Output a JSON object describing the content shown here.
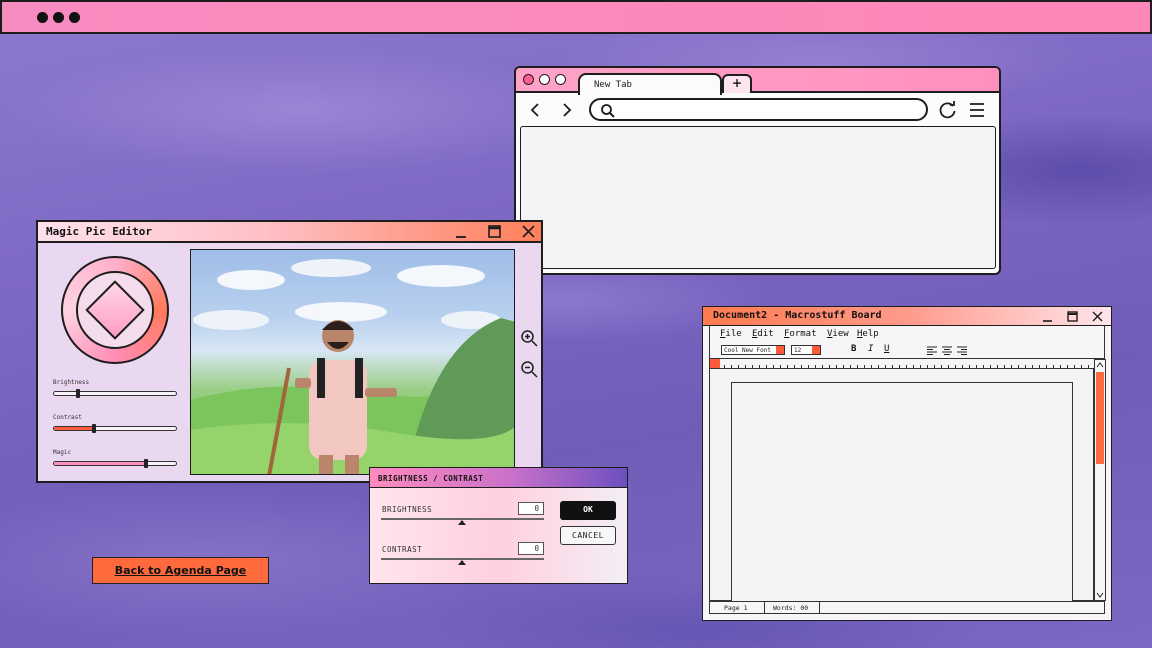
{
  "browser": {
    "tab_label": "New Tab",
    "new_tab_symbol": "+",
    "address_value": ""
  },
  "pic_editor": {
    "title": "Magic Pic Editor",
    "sliders": [
      {
        "label": "Brightness",
        "value": 0.2,
        "fill": "#f9f1f8"
      },
      {
        "label": "Contrast",
        "value": 0.33,
        "fill": "#ff5a3c"
      },
      {
        "label": "Magic",
        "value": 0.75,
        "fill": "#ff8fc0"
      }
    ]
  },
  "brightness_dialog": {
    "title": "BRIGHTNESS / CONTRAST",
    "brightness_label": "BRIGHTNESS",
    "brightness_value": "0",
    "contrast_label": "CONTRAST",
    "contrast_value": "0",
    "ok_label": "OK",
    "cancel_label": "CANCEL"
  },
  "document": {
    "title": "Document2 - Macrostuff Board",
    "menus": [
      {
        "accel": "F",
        "rest": "ile"
      },
      {
        "accel": "E",
        "rest": "dit"
      },
      {
        "accel": "F",
        "rest": "ormat"
      },
      {
        "accel": "V",
        "rest": "iew"
      },
      {
        "accel": "H",
        "rest": "elp"
      }
    ],
    "font_name": "Cool New Font",
    "font_size": "12",
    "bold": "B",
    "italic": "I",
    "underline": "U",
    "status_page": "Page 1",
    "status_words": "Words: 00"
  },
  "back_button": "Back to Agenda Page",
  "colors": {
    "accent_pink": "#ff86b8",
    "accent_orange": "#ff6a3c",
    "background_purple": "#7d68c4"
  }
}
